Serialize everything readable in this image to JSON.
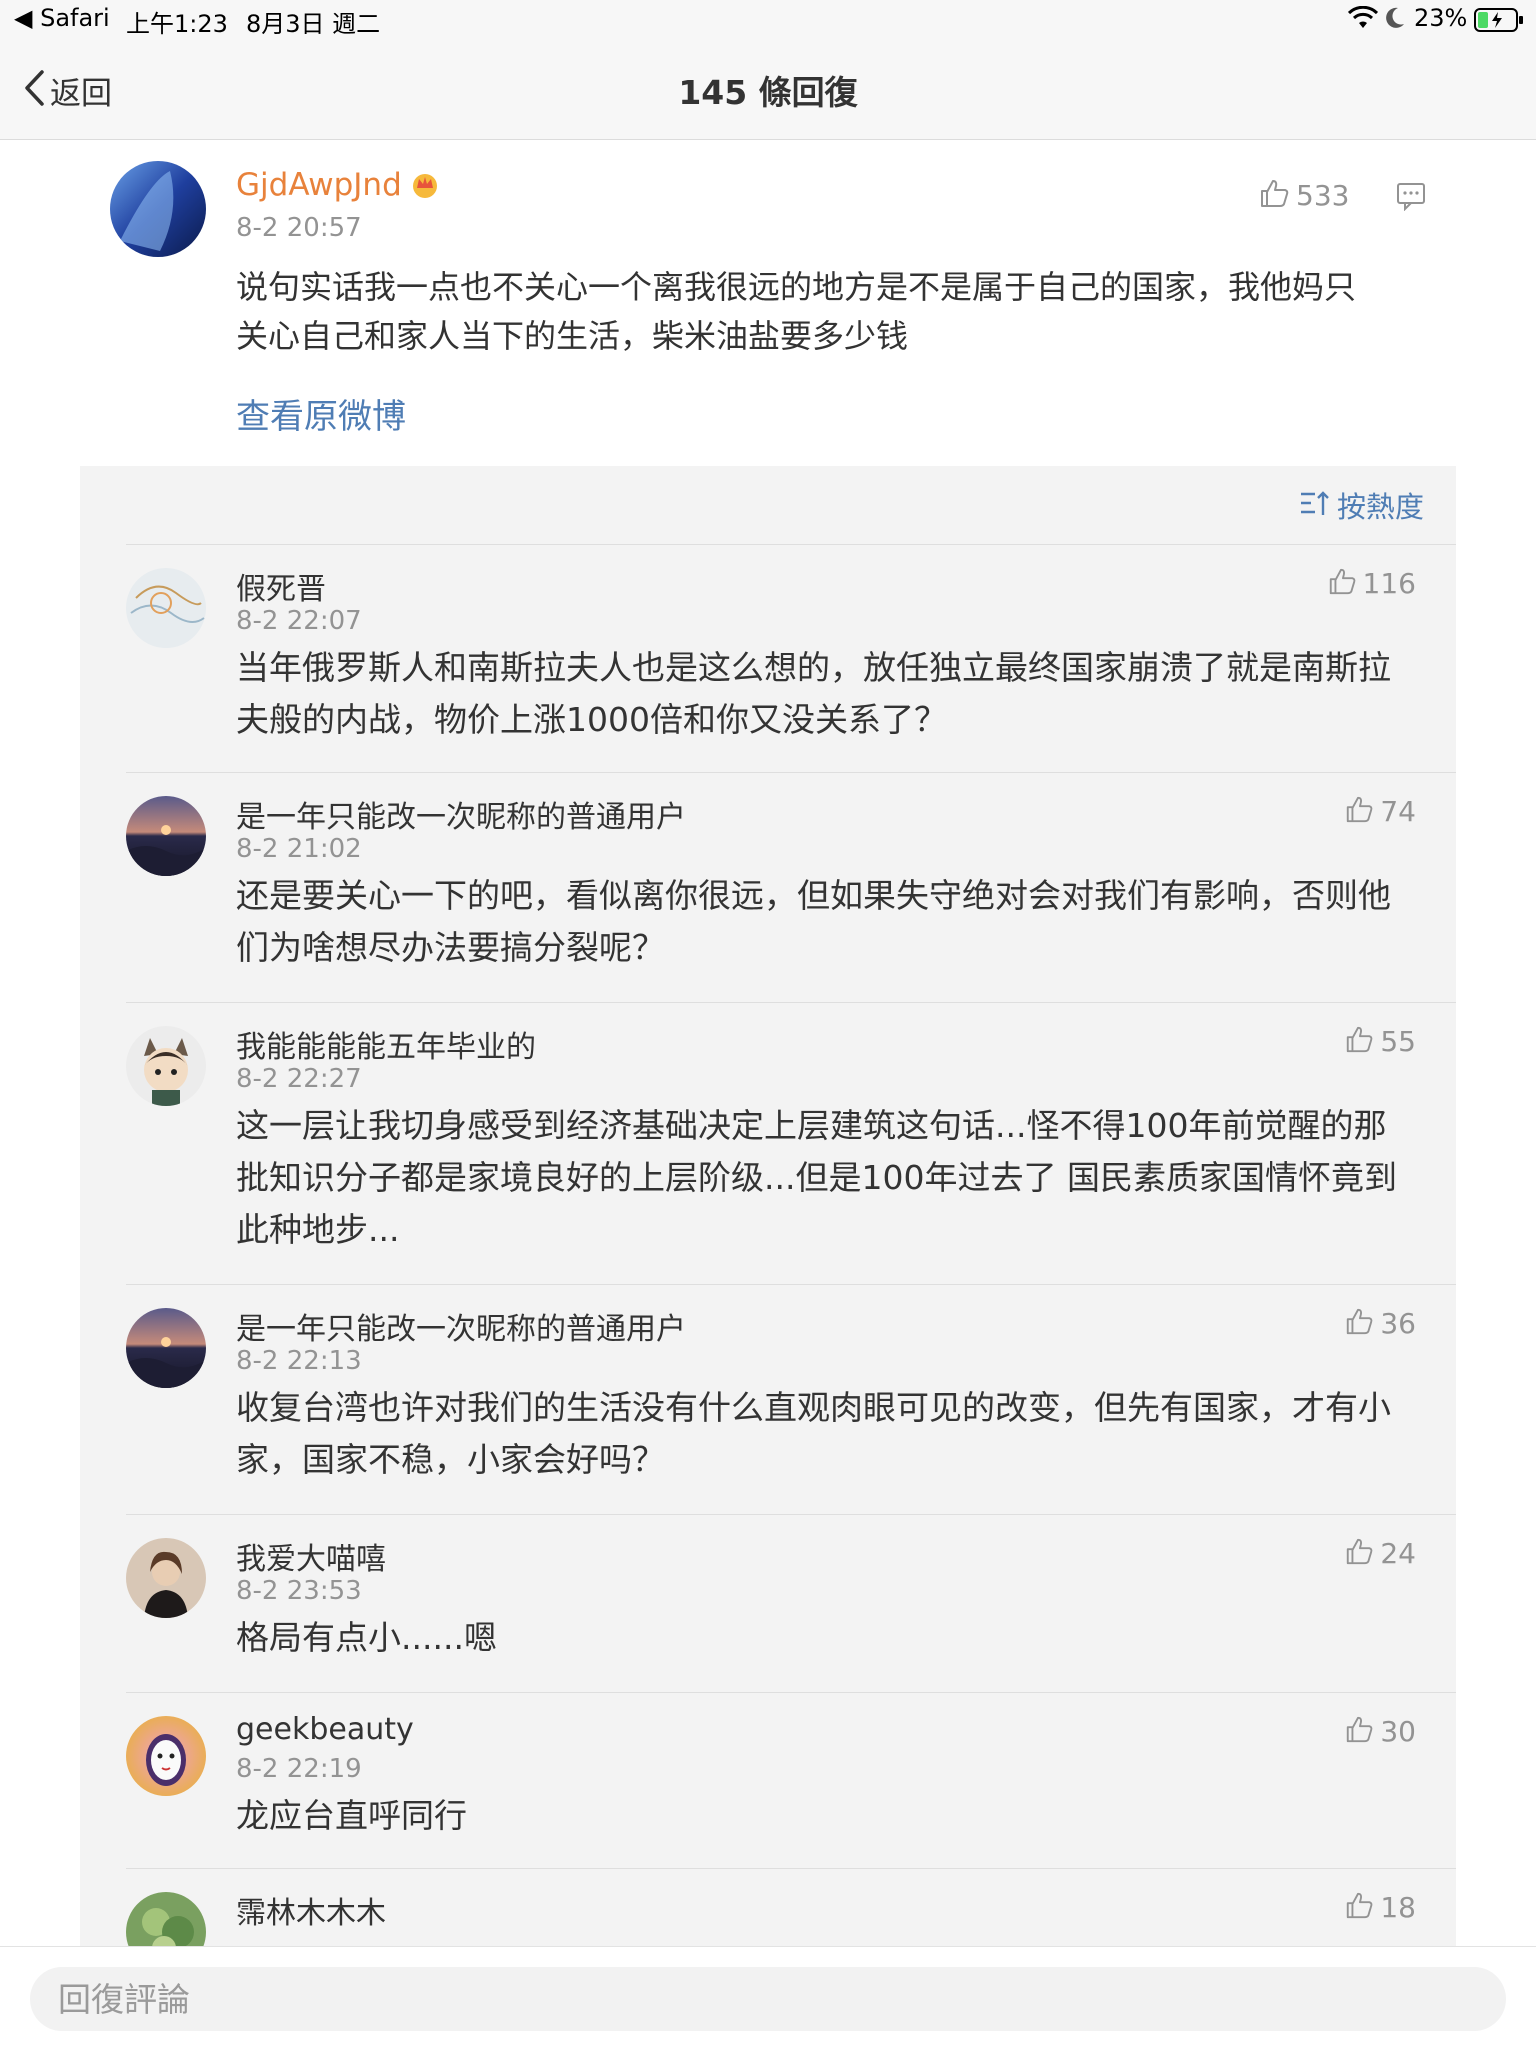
{
  "status_bar": {
    "back_app": "◀ Safari",
    "time": "上午1:23",
    "date": "8月3日 週二",
    "battery": "23%"
  },
  "nav": {
    "back_label": "返回",
    "title": "145 條回復"
  },
  "post": {
    "username": "GjdAwpJnd",
    "time": "8-2 20:57",
    "likes": "533",
    "text": "说句实话我一点也不关心一个离我很远的地方是不是属于自己的国家，我他妈只关心自己和家人当下的生活，柴米油盐要多少钱",
    "view_original": "查看原微博"
  },
  "sort": {
    "label": "按熱度"
  },
  "replies": [
    {
      "username": "假死晋",
      "time": "8-2 22:07",
      "likes": "116",
      "text": "当年俄罗斯人和南斯拉夫人也是这么想的，放任独立最终国家崩溃了就是南斯拉夫般的内战，物价上涨1000倍和你又没关系了？"
    },
    {
      "username": "是一年只能改一次昵称的普通用户",
      "time": "8-2 21:02",
      "likes": "74",
      "text": "还是要关心一下的吧，看似离你很远，但如果失守绝对会对我们有影响，否则他们为啥想尽办法要搞分裂呢？"
    },
    {
      "username": "我能能能能五年毕业的",
      "time": "8-2 22:27",
      "likes": "55",
      "text": "这一层让我切身感受到经济基础决定上层建筑这句话...怪不得100年前觉醒的那批知识分子都是家境良好的上层阶级...但是100年过去了 国民素质家国情怀竟到此种地步..."
    },
    {
      "username": "是一年只能改一次昵称的普通用户",
      "time": "8-2 22:13",
      "likes": "36",
      "text": "收复台湾也许对我们的生活没有什么直观肉眼可见的改变，但先有国家，才有小家，国家不稳，小家会好吗？"
    },
    {
      "username": "我爱大喵嘻",
      "time": "8-2 23:53",
      "likes": "24",
      "text": "格局有点小......嗯"
    },
    {
      "username": "geekbeauty",
      "time": "8-2 22:19",
      "likes": "30",
      "text": "龙应台直呼同行"
    },
    {
      "username": "霈林木木木",
      "time": "",
      "likes": "18",
      "text": ""
    }
  ],
  "bottom": {
    "placeholder": "回復評論"
  },
  "colors": {
    "accent_link": "#4f7db4",
    "username_vip": "#e8823b",
    "muted": "#939393",
    "panel_bg": "#f3f3f3"
  },
  "icons": [
    "back-chevron-icon",
    "wifi-icon",
    "moon-icon",
    "battery-icon",
    "vip-crown-icon",
    "thumbs-up-icon",
    "comment-icon",
    "sort-icon"
  ]
}
